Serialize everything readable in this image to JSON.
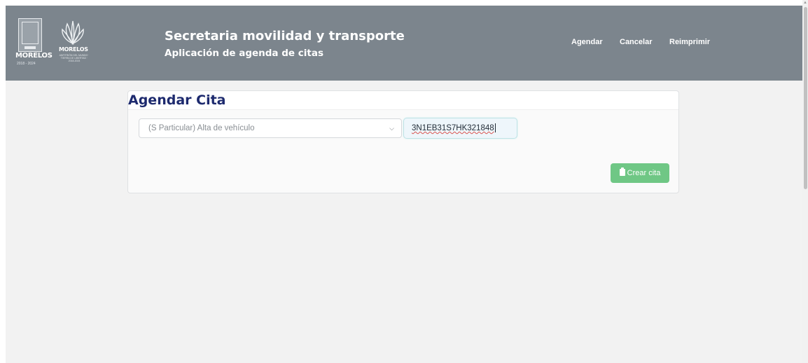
{
  "logo": {
    "state_name": "MORELOS",
    "state_years": "2018 - 2024",
    "secondary_name": "MORELOS",
    "secondary_caption": "ANFITRIÓN DEL MUNDO · TIERRA DE LIBERTAD · 2018-2024"
  },
  "header": {
    "title": "Secretaria movilidad y transporte",
    "subtitle": "Aplicación de agenda de citas"
  },
  "nav": {
    "agendar": "Agendar",
    "cancelar": "Cancelar",
    "reimprimir": "Reimprimir"
  },
  "card": {
    "title": "Agendar Cita",
    "select_value": "(S Particular) Alta de vehículo",
    "vin_value": "3N1EB31S7HK321848",
    "create_button": "Crear cita"
  },
  "colors": {
    "header_bg": "#7c858d",
    "title_color": "#1d2a6e",
    "button_bg": "#6fc785",
    "page_bg": "#f2f2f2"
  },
  "icons": {
    "dropdown": "chevron-down-icon",
    "create_button": "clipboard-icon"
  }
}
